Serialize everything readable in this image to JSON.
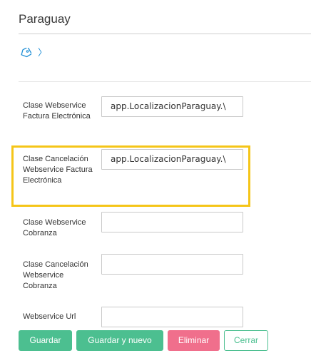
{
  "page": {
    "title": "Paraguay",
    "breadcrumb_icon": "tag-icon",
    "breadcrumb_separator": "〉"
  },
  "fields": [
    {
      "label": "Clase Webservice Factura Electrónica",
      "value": "app.LocalizacionParaguay.\\"
    },
    {
      "label": "Clase Cancelación Webservice Factura Electrónica",
      "value": "app.LocalizacionParaguay.\\"
    },
    {
      "label": "Clase Webservice Cobranza",
      "value": ""
    },
    {
      "label": "Clase Cancelación Webservice Cobranza",
      "value": ""
    },
    {
      "label": "Webservice Url",
      "value": ""
    }
  ],
  "buttons": {
    "save": "Guardar",
    "save_new": "Guardar y nuevo",
    "delete": "Eliminar",
    "close": "Cerrar"
  },
  "colors": {
    "highlight": "#f5c518",
    "primary": "#4cbf90",
    "danger": "#f06f8c",
    "link": "#1f8fd6"
  }
}
